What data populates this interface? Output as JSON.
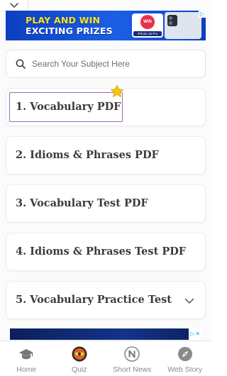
{
  "banner": {
    "line1": "PLAY AND WIN",
    "line2": "EXCITING PRIZES",
    "badge_text": "WIN",
    "badge_caption": "iPhone 15 Pro"
  },
  "search": {
    "placeholder": "Search Your Subject Here"
  },
  "items": [
    {
      "label": "1. Vocabulary PDF"
    },
    {
      "label": "2. Idioms & Phrases PDF"
    },
    {
      "label": "3. Vocabulary Test PDF"
    },
    {
      "label": "4. Idioms & Phrases Test PDF"
    },
    {
      "label": "5. Vocabulary Practice Test"
    }
  ],
  "nav": [
    {
      "label": "Home",
      "icon": "graduation-cap-icon"
    },
    {
      "label": "Quiz",
      "icon": "quiz-badge-icon"
    },
    {
      "label": "Short News",
      "icon": "news-n-icon"
    },
    {
      "label": "Web Story",
      "icon": "compass-icon"
    }
  ],
  "colors": {
    "banner_bg": "#1b5fe6",
    "banner_text": "#ffe21f",
    "focus_border": "#9b6bb5",
    "star": "#f5c518",
    "nav_label": "#8a8a8a"
  }
}
